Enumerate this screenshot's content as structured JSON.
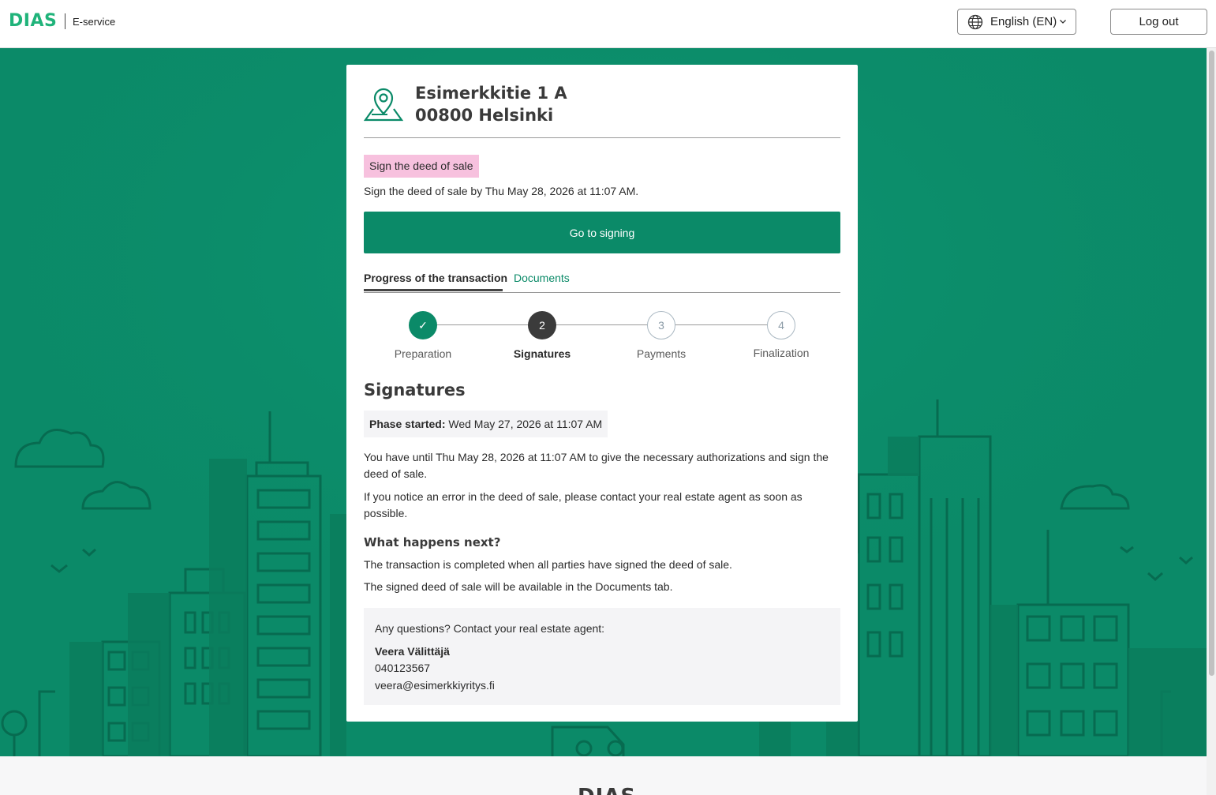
{
  "header": {
    "logo": "DIAS",
    "subtitle": "E-service",
    "language": "English (EN)",
    "logout_label": "Log out"
  },
  "property": {
    "address_line1": "Esimerkkitie 1 A",
    "address_line2": "00800 Helsinki"
  },
  "task": {
    "badge": "Sign the deed of sale",
    "deadline_text": "Sign the deed of sale by Thu May 28, 2026 at 11:07 AM.",
    "button_label": "Go to signing"
  },
  "tabs": [
    {
      "label": "Progress of the transaction",
      "active": true
    },
    {
      "label": "Documents",
      "active": false
    }
  ],
  "steps": [
    {
      "marker": "✓",
      "label": "Preparation",
      "state": "done"
    },
    {
      "marker": "2",
      "label": "Signatures",
      "state": "active"
    },
    {
      "marker": "3",
      "label": "Payments",
      "state": "todo"
    },
    {
      "marker": "4",
      "label": "Finalization",
      "state": "todo"
    }
  ],
  "phase": {
    "title": "Signatures",
    "started_label": "Phase started:",
    "started_value": "Wed May 27, 2026 at 11:07 AM",
    "paragraph1": "You have until Thu May 28, 2026 at 11:07 AM to give the necessary authorizations and sign the deed of sale.",
    "paragraph2": "If you notice an error in the deed of sale, please contact your real estate agent as soon as possible.",
    "next_title": "What happens next?",
    "next1": "The transaction is completed when all parties have signed the deed of sale.",
    "next2": "The signed deed of sale will be available in the Documents tab."
  },
  "contact": {
    "question": "Any questions? Contact your real estate agent:",
    "name": "Veera Välittäjä",
    "phone": "040123567",
    "email": "veera@esimerkkiyritys.fi"
  },
  "footer": {
    "logo": "DIAS"
  },
  "colors": {
    "brand_green": "#0b8a68",
    "logo_green": "#20b37a",
    "badge_pink": "#f7c1de"
  },
  "icons": {
    "address": "map-pin-icon",
    "language": "globe-icon",
    "dropdown": "chevron-down-icon",
    "done_step": "check-icon"
  }
}
